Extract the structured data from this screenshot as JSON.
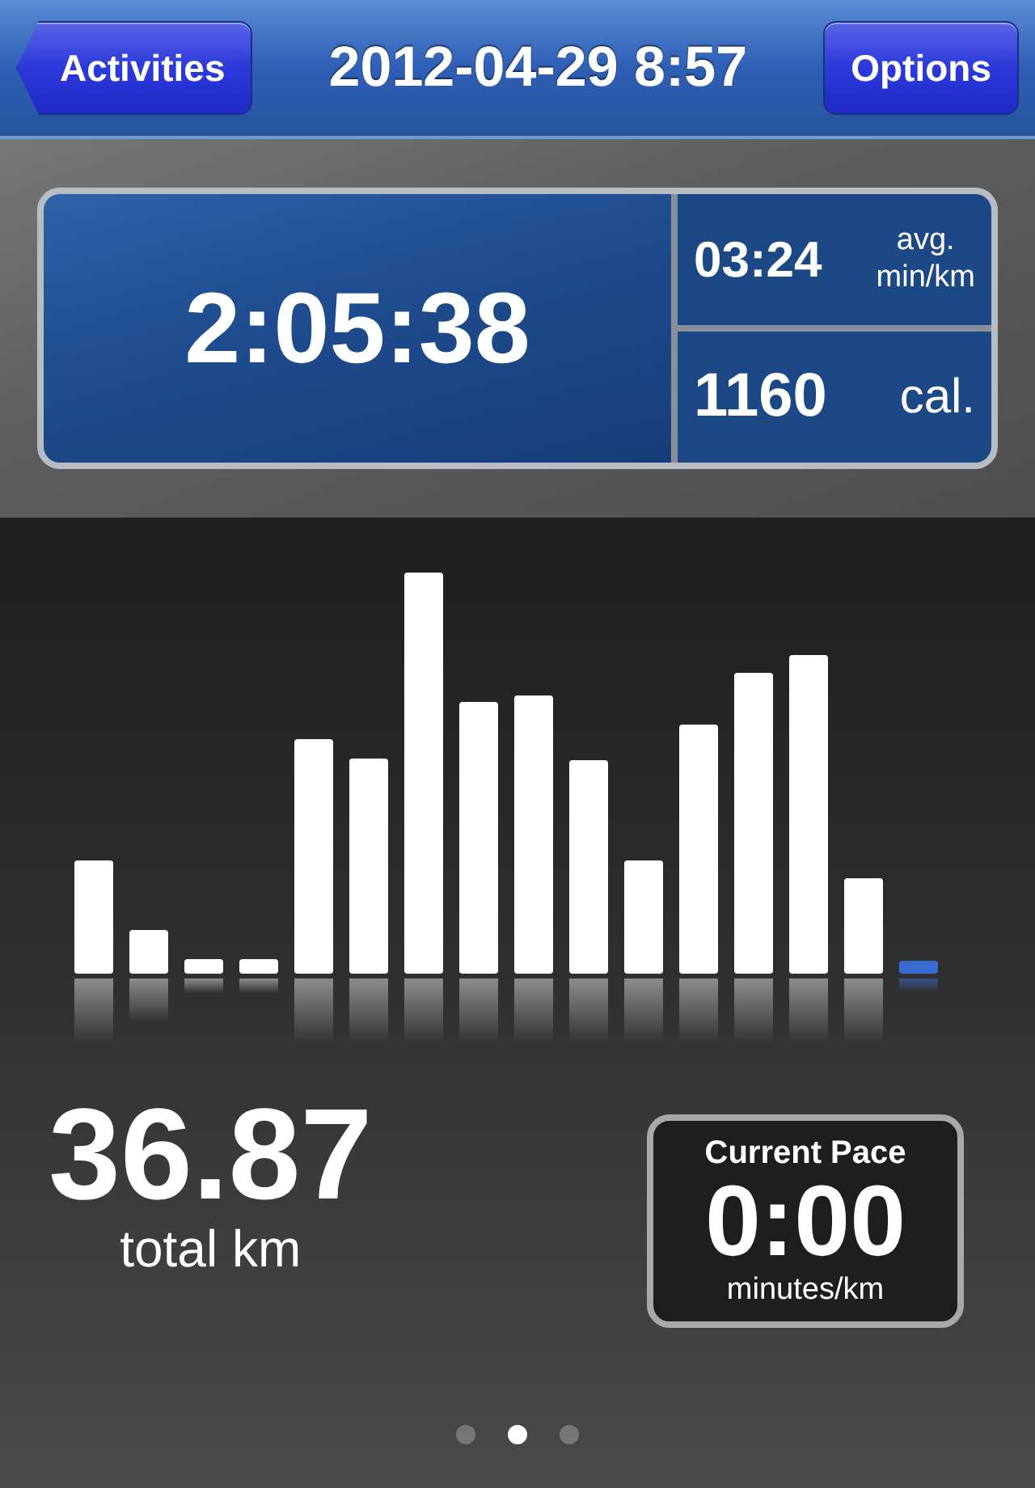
{
  "nav_bar": {
    "back_button": "Activities",
    "title": "2012-04-29 8:57",
    "options_button": "Options"
  },
  "summary": {
    "duration": "2:05:38",
    "pace": {
      "value": "03:24",
      "unit_top": "avg.",
      "unit_bottom": "min/km"
    },
    "calories": {
      "value": "1160",
      "unit": "cal."
    }
  },
  "distance": {
    "value": "36.87",
    "unit": "total km"
  },
  "current_pace": {
    "label": "Current Pace",
    "value": "0:00",
    "unit": "minutes/km"
  },
  "page_dots": [
    {
      "selected": false
    },
    {
      "selected": true
    },
    {
      "selected": false
    }
  ]
}
